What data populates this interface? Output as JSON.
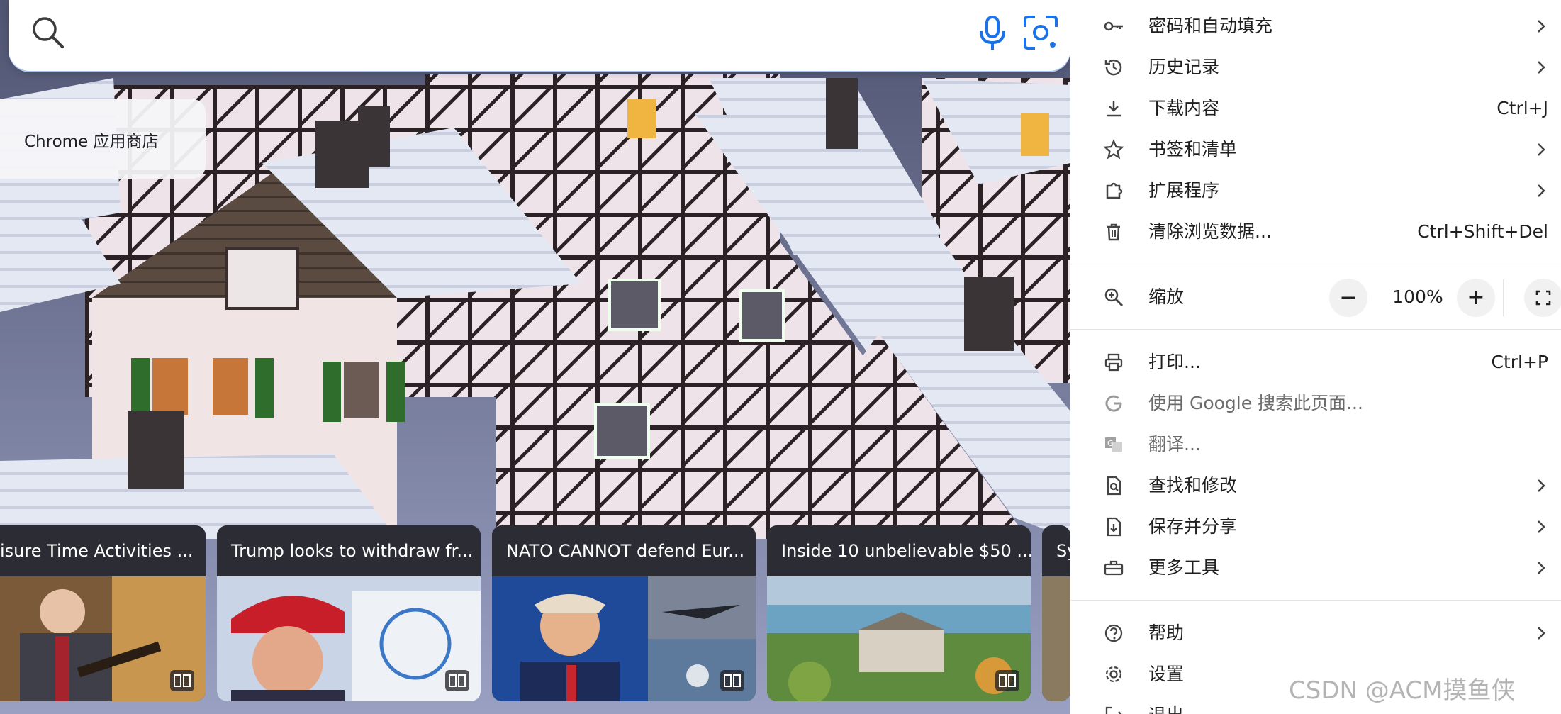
{
  "search": {
    "placeholder": ""
  },
  "shortcut_tile": {
    "label": "Chrome 应用商店"
  },
  "news": [
    {
      "title": "isure Time Activities ..."
    },
    {
      "title": "Trump looks to withdraw fr..."
    },
    {
      "title": "NATO CANNOT defend Eur..."
    },
    {
      "title": "Inside 10 unbelievable $50 ..."
    },
    {
      "title": "Sy"
    }
  ],
  "menu": {
    "items_top": [
      {
        "label": "密码和自动填充",
        "shortcut": "",
        "submenu": true,
        "icon": "key-icon"
      },
      {
        "label": "历史记录",
        "shortcut": "",
        "submenu": true,
        "icon": "history-icon"
      },
      {
        "label": "下载内容",
        "shortcut": "Ctrl+J",
        "submenu": false,
        "icon": "download-icon"
      },
      {
        "label": "书签和清单",
        "shortcut": "",
        "submenu": true,
        "icon": "star-icon"
      },
      {
        "label": "扩展程序",
        "shortcut": "",
        "submenu": true,
        "icon": "puzzle-icon"
      },
      {
        "label": "清除浏览数据...",
        "shortcut": "Ctrl+Shift+Del",
        "submenu": false,
        "icon": "trash-icon"
      }
    ],
    "zoom": {
      "label": "缩放",
      "minus": "−",
      "value": "100%",
      "plus": "+"
    },
    "items_mid": [
      {
        "label": "打印...",
        "shortcut": "Ctrl+P",
        "submenu": false,
        "icon": "print-icon"
      },
      {
        "label": "使用 Google 搜索此页面...",
        "shortcut": "",
        "submenu": false,
        "icon": "google-icon",
        "disabled": true
      },
      {
        "label": "翻译...",
        "shortcut": "",
        "submenu": false,
        "icon": "translate-icon",
        "disabled": true
      },
      {
        "label": "查找和修改",
        "shortcut": "",
        "submenu": true,
        "icon": "find-icon"
      },
      {
        "label": "保存并分享",
        "shortcut": "",
        "submenu": true,
        "icon": "save-share-icon"
      },
      {
        "label": "更多工具",
        "shortcut": "",
        "submenu": true,
        "icon": "toolbox-icon"
      }
    ],
    "items_bottom": [
      {
        "label": "帮助",
        "shortcut": "",
        "submenu": true,
        "icon": "help-icon"
      },
      {
        "label": "设置",
        "shortcut": "",
        "submenu": false,
        "icon": "gear-icon"
      },
      {
        "label": "退出",
        "shortcut": "",
        "submenu": false,
        "icon": "exit-icon"
      }
    ]
  },
  "watermark": "CSDN @ACM摸鱼侠",
  "colors": {
    "accent": "#1a73e8",
    "menu_bg": "#ffffff",
    "disabled_text": "#6b6b6b"
  }
}
